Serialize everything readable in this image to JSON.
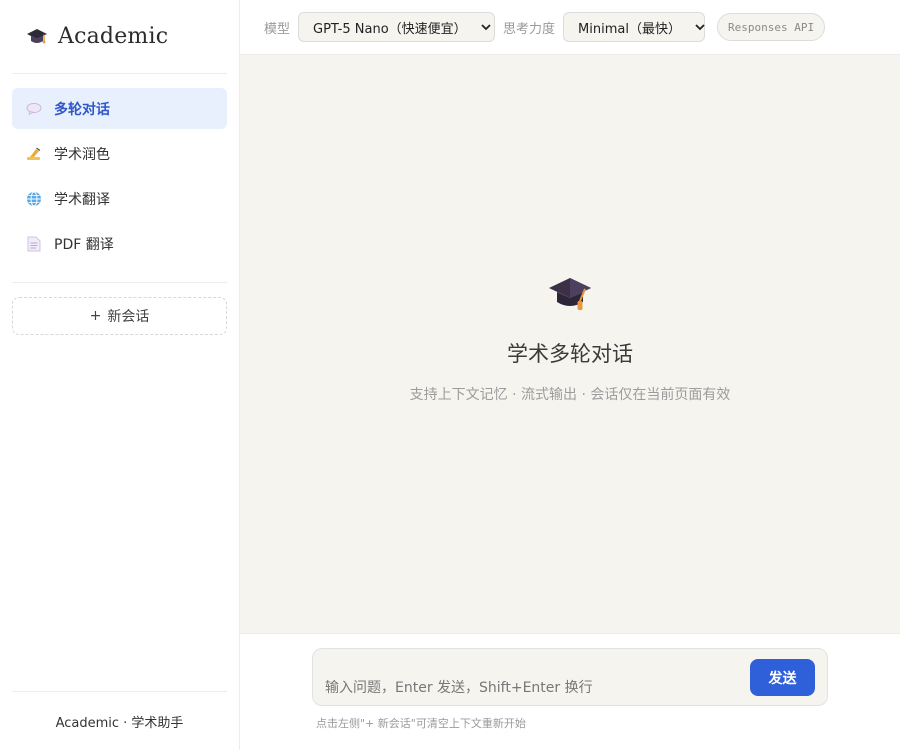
{
  "brand": {
    "title": "Academic",
    "icon": "graduation-cap-icon"
  },
  "nav": {
    "items": [
      {
        "label": "多轮对话",
        "icon": "chat-bubble-icon",
        "active": true
      },
      {
        "label": "学术润色",
        "icon": "writing-hand-icon",
        "active": false
      },
      {
        "label": "学术翻译",
        "icon": "globe-icon",
        "active": false
      },
      {
        "label": "PDF 翻译",
        "icon": "document-icon",
        "active": false
      }
    ]
  },
  "new_chat": {
    "plus": "+",
    "label": "新会话"
  },
  "footer": {
    "text": "Academic · 学术助手"
  },
  "topbar": {
    "model_label": "模型",
    "model_value": "GPT-5 Nano（快速便宜）",
    "effort_label": "思考力度",
    "effort_value": "Minimal（最快）",
    "api_badge": "Responses API"
  },
  "hero": {
    "icon": "graduation-cap-icon",
    "title": "学术多轮对话",
    "subtitle": "支持上下文记忆 · 流式输出 · 会话仅在当前页面有效"
  },
  "composer": {
    "placeholder": "输入问题，Enter 发送，Shift+Enter 换行",
    "send_label": "发送",
    "hint": "点击左侧\"+ 新会话\"可清空上下文重新开始"
  },
  "colors": {
    "accent": "#2f5fd9",
    "active_nav_bg": "#e8f0fd",
    "active_nav_text": "#2f57c7",
    "canvas_bg": "#f6f4ef"
  }
}
